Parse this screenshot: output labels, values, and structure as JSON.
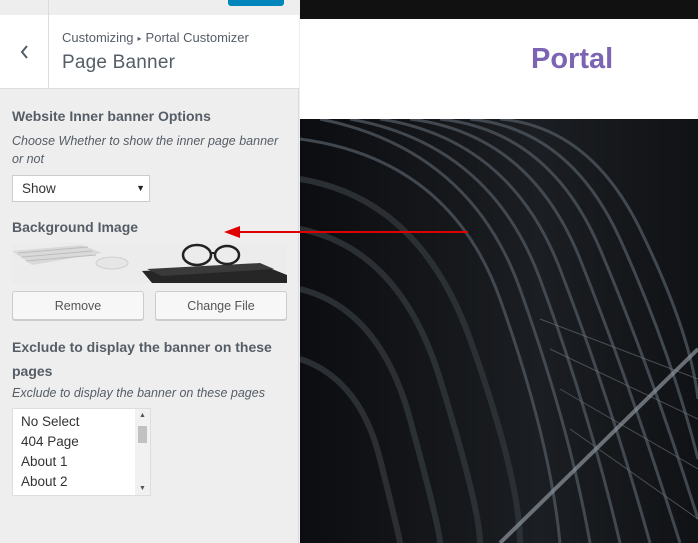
{
  "header": {
    "breadcrumb_root": "Customizing",
    "breadcrumb_sep": "▸",
    "breadcrumb_parent": "Portal Customizer",
    "section_title": "Page Banner"
  },
  "inner_banner": {
    "title": "Website Inner banner Options",
    "description": "Choose Whether to show the inner page banner or not",
    "selected": "Show"
  },
  "background_image": {
    "title": "Background Image",
    "remove_label": "Remove",
    "change_label": "Change File"
  },
  "exclude": {
    "title": "Exclude to display the banner on these pages",
    "description": "Exclude to display the banner on these pages",
    "options": [
      "No Select",
      "404 Page",
      "About 1",
      "About 2"
    ]
  },
  "preview": {
    "logo_text": "Portal"
  },
  "colors": {
    "accent": "#0085ba",
    "logo": "#7b64b2",
    "annotation": "#e00000"
  }
}
